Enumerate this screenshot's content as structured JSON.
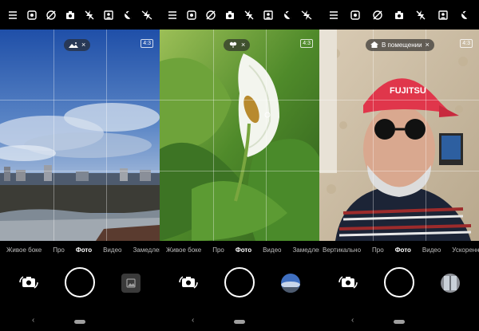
{
  "topbar_icons": [
    "menu-icon",
    "timer-icon",
    "hdr-off-icon",
    "bokeh-icon",
    "flash-off-icon",
    "portrait-icon",
    "night-icon",
    "flash-auto-icon"
  ],
  "panels": [
    {
      "scene_chip": {
        "label": "",
        "icon": "landscape-icon",
        "close": "×"
      },
      "ratio_badge": "4:3",
      "modes": [
        "Живое боке",
        "Про",
        "Фото",
        "Видео",
        "Замедленн"
      ],
      "active_mode": "Фото",
      "thumbnail": "empty"
    },
    {
      "scene_chip": {
        "label": "",
        "icon": "flower-icon",
        "close": "×"
      },
      "ratio_badge": "4:3",
      "modes": [
        "Живое боке",
        "Про",
        "Фото",
        "Видео",
        "Замедленн"
      ],
      "active_mode": "Фото",
      "thumbnail": "sky-photo"
    },
    {
      "scene_chip": {
        "label": "В помещении",
        "icon": "indoor-icon",
        "close": "×"
      },
      "ratio_badge": "4:3",
      "modes": [
        "Вертикально",
        "Про",
        "Фото",
        "Видео",
        "Ускоренное"
      ],
      "active_mode": "Фото",
      "thumbnail": "window-photo"
    }
  ],
  "p1": {
    "chip_close": "×",
    "ratio": "4:3",
    "m0": "Живое боке",
    "m1": "Про",
    "m2": "Фото",
    "m3": "Видео",
    "m4": "Замедленн",
    "back": "‹"
  },
  "p2": {
    "chip_close": "×",
    "ratio": "4:3",
    "m0": "Живое боке",
    "m1": "Про",
    "m2": "Фото",
    "m3": "Видео",
    "m4": "Замедленн",
    "back": "‹"
  },
  "p3": {
    "chip_label": "В помещении",
    "chip_close": "×",
    "ratio": "4:3",
    "m0": "Вертикально",
    "m1": "Про",
    "m2": "Фото",
    "m3": "Видео",
    "m4": "Ускоренное",
    "back": "‹"
  },
  "colors": {
    "background": "#000000",
    "inactive_mode": "#bdbdbd",
    "active_mode": "#ffffff"
  }
}
